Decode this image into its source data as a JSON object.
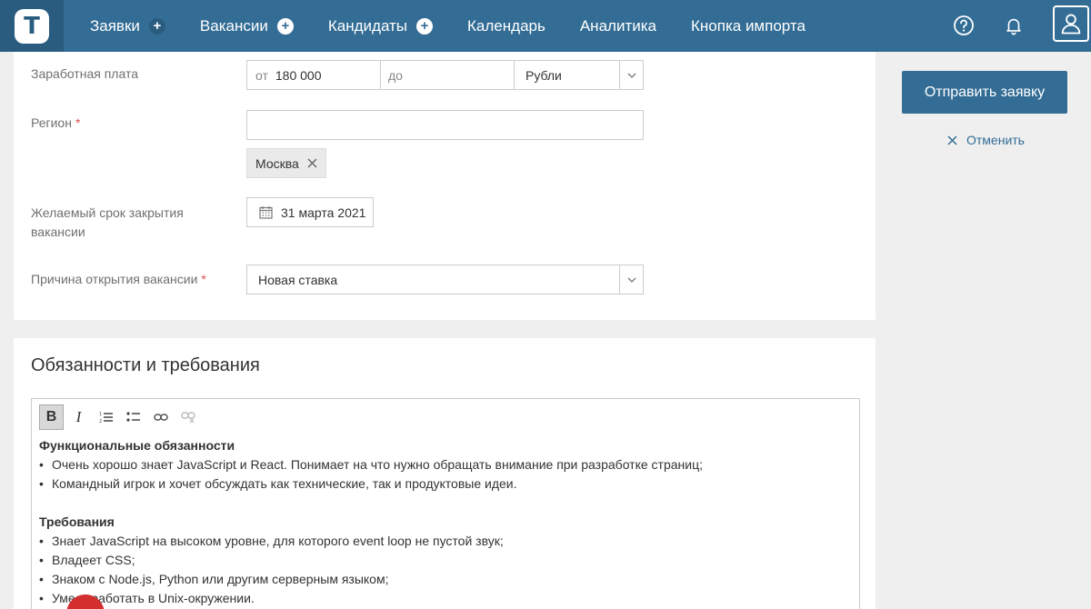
{
  "nav": {
    "logo_letter": "T",
    "items": [
      {
        "label": "Заявки",
        "has_plus": true,
        "plus_style": "dark"
      },
      {
        "label": "Вакансии",
        "has_plus": true,
        "plus_style": "light"
      },
      {
        "label": "Кандидаты",
        "has_plus": true,
        "plus_style": "light"
      },
      {
        "label": "Календарь",
        "has_plus": false
      },
      {
        "label": "Аналитика",
        "has_plus": false
      },
      {
        "label": "Кнопка импорта",
        "has_plus": false
      }
    ],
    "plus_symbol": "+",
    "icons": [
      "help-icon",
      "bell-icon",
      "user-icon"
    ]
  },
  "form": {
    "salary": {
      "label": "Заработная плата",
      "from_prefix": "от",
      "from_value": "180 000",
      "to_placeholder": "до",
      "currency": "Рубли"
    },
    "region": {
      "label": "Регион",
      "required_mark": "*",
      "input_value": "",
      "tags": [
        "Москва"
      ]
    },
    "deadline": {
      "label": "Желаемый срок закрытия вакансии",
      "value": "31 марта 2021"
    },
    "reason": {
      "label": "Причина открытия вакансии",
      "required_mark": "*",
      "value": "Новая ставка"
    }
  },
  "actions": {
    "send_label": "Отправить заявку",
    "cancel_label": "Отменить"
  },
  "editor": {
    "heading": "Обязанности и требования",
    "toolbar": [
      {
        "name": "bold-button",
        "glyph": "B",
        "active": true
      },
      {
        "name": "italic-button",
        "glyph": "I",
        "active": false
      },
      {
        "name": "numbered-list-button",
        "glyph": "numbered-list-icon",
        "active": false
      },
      {
        "name": "bullet-list-button",
        "glyph": "bullet-list-icon",
        "active": false
      },
      {
        "name": "link-button",
        "glyph": "link-icon",
        "active": false
      },
      {
        "name": "unlink-button",
        "glyph": "unlink-icon",
        "active": false
      }
    ],
    "sections": [
      {
        "title": "Функциональные обязанности",
        "items": [
          "Очень хорошо знает JavaScript и React. Понимает на что нужно обращать внимание при разработке страниц;",
          "Командный игрок и хочет обсуждать как технические, так и продуктовые идеи."
        ]
      },
      {
        "title": "Требования",
        "items": [
          "Знает JavaScript на высоком уровне, для которого event loop не пустой звук;",
          "Владеет CSS;",
          "Знаком с Node.js, Python или другим серверным языком;",
          "Умеет работать в Unix-окружении."
        ]
      }
    ]
  },
  "colors": {
    "topbar": "#336d95",
    "logo_bg": "#2a5c80",
    "accent": "#336d95",
    "required": "#d9534f",
    "badge": "#d32f2f"
  }
}
